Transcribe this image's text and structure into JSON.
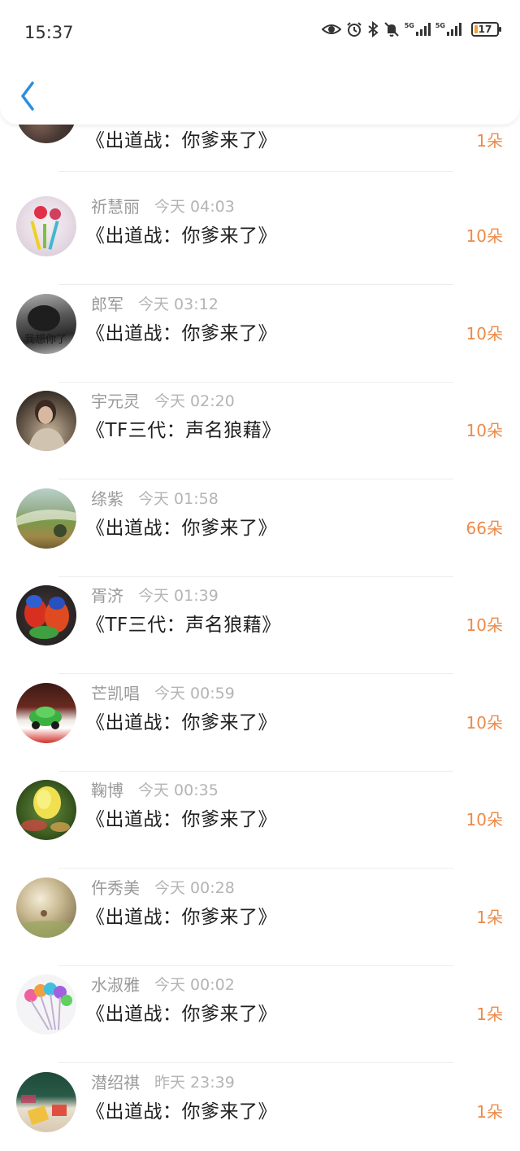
{
  "status_bar": {
    "time": "15:37",
    "network1": "5G",
    "network2": "5G",
    "battery": "17",
    "icons": [
      "eye-icon",
      "alarm-icon",
      "bluetooth-icon",
      "mute-bell-icon",
      "signal-icon",
      "signal-icon",
      "battery-icon"
    ]
  },
  "header": {
    "back_icon": "back-arrow-icon",
    "accent": "#2a8ee0"
  },
  "colors": {
    "flower_count": "#ec8b4a",
    "name": "#9a9a9a",
    "time": "#b4b4b4"
  },
  "gifts": [
    {
      "name": "",
      "time": "",
      "title": "《出道战：你爹来了》",
      "flowers": "1朵"
    },
    {
      "name": "祈慧丽",
      "time": "今天 04:03",
      "title": "《出道战：你爹来了》",
      "flowers": "10朵"
    },
    {
      "name": "郎军",
      "time": "今天 03:12",
      "title": "《出道战：你爹来了》",
      "flowers": "10朵",
      "avatar_text": "我想你了"
    },
    {
      "name": "宇元灵",
      "time": "今天 02:20",
      "title": "《TF三代：声名狼藉》",
      "flowers": "10朵"
    },
    {
      "name": "绦紫",
      "time": "今天 01:58",
      "title": "《出道战：你爹来了》",
      "flowers": "66朵"
    },
    {
      "name": "胥济",
      "time": "今天 01:39",
      "title": "《TF三代：声名狼藉》",
      "flowers": "10朵"
    },
    {
      "name": "芒凯唱",
      "time": "今天 00:59",
      "title": "《出道战：你爹来了》",
      "flowers": "10朵"
    },
    {
      "name": "鞠博",
      "time": "今天 00:35",
      "title": "《出道战：你爹来了》",
      "flowers": "10朵"
    },
    {
      "name": "仵秀美",
      "time": "今天 00:28",
      "title": "《出道战：你爹来了》",
      "flowers": "1朵"
    },
    {
      "name": "水淑雅",
      "time": "今天 00:02",
      "title": "《出道战：你爹来了》",
      "flowers": "1朵"
    },
    {
      "name": "潜绍祺",
      "time": "昨天 23:39",
      "title": "《出道战：你爹来了》",
      "flowers": "1朵"
    }
  ]
}
